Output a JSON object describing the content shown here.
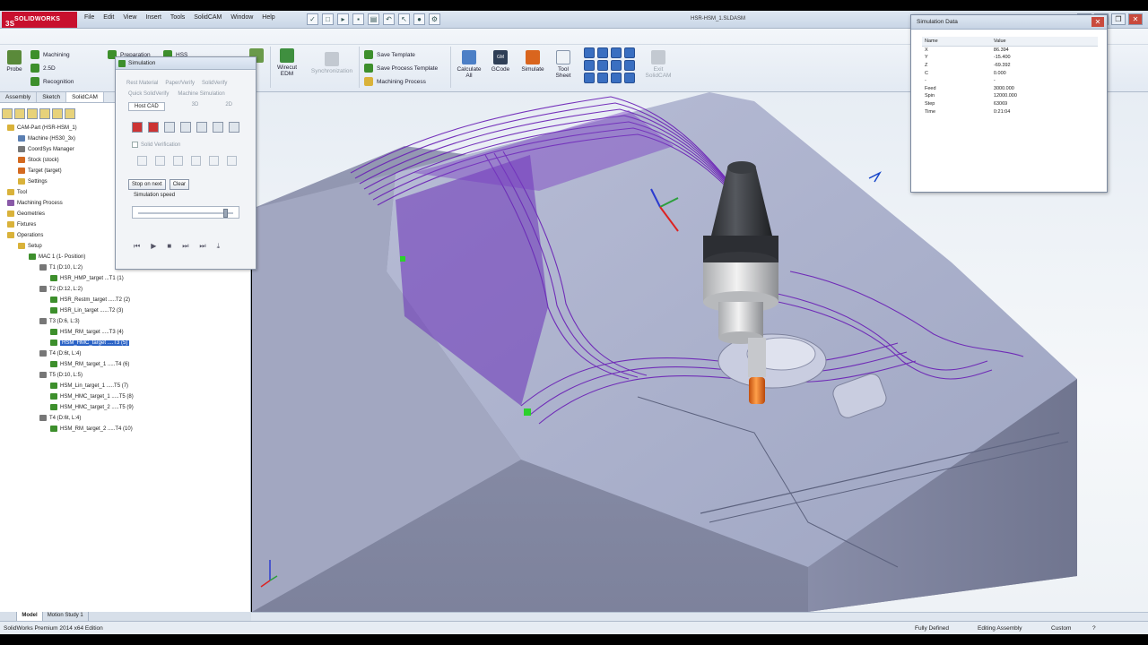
{
  "app": {
    "logo_text": "SOLIDWORKS",
    "document_title": "HSR-HSM_1.SLDASM"
  },
  "menu": [
    "File",
    "Edit",
    "View",
    "Insert",
    "Tools",
    "SolidCAM",
    "Window",
    "Help"
  ],
  "command_manager": {
    "probe": "Probe",
    "machining": "Machining",
    "two_five_d": "2.5D",
    "recognition": "Recognition",
    "preparation": "Preparation",
    "hss": "HSS",
    "simulation": "Simulation",
    "wirecut_edm": "Wirecut EDM",
    "synchronization": "Synchronization",
    "save_template": "Save Template",
    "save_process_template": "Save Process Template",
    "machining_process": "Machining Process",
    "calculate_all": "Calculate All",
    "gcode": "GCode",
    "simulate": "Simulate",
    "tool_sheet": "Tool Sheet",
    "exit_solidcam": "Exit SolidCAM"
  },
  "tabs": [
    "Assembly",
    "Sketch",
    "SolidCAM"
  ],
  "tree": [
    {
      "label": "CAM-Part (HSR-HSM_1)",
      "icon": "cam-part-icon"
    },
    {
      "label": "Machine (HS30_3x)",
      "icon": "machine-icon"
    },
    {
      "label": "CoordSys Manager",
      "icon": "coordsys-icon"
    },
    {
      "label": "Stock (stock)",
      "icon": "stock-icon"
    },
    {
      "label": "Target (target)",
      "icon": "target-icon"
    },
    {
      "label": "Settings",
      "icon": "settings-icon"
    },
    {
      "label": "Tool",
      "icon": "tool-icon"
    },
    {
      "label": "Machining Process",
      "icon": "process-icon"
    },
    {
      "label": "Geometries",
      "icon": "geometries-icon"
    },
    {
      "label": "Fixtures",
      "icon": "fixtures-icon"
    },
    {
      "label": "Operations",
      "icon": "operations-icon"
    },
    {
      "label": "Setup",
      "icon": "setup-icon"
    },
    {
      "label": "MAC 1 (1- Position)",
      "icon": "mac-icon"
    },
    {
      "label": "T1 (D:10, L:2)",
      "icon": "tool-group-icon"
    },
    {
      "label": "HSR_HMP_target ...T1 (1)",
      "icon": "operation-icon"
    },
    {
      "label": "T2 (D:12, L:2)",
      "icon": "tool-group-icon"
    },
    {
      "label": "HSR_Restm_target .....T2 (2)",
      "icon": "operation-icon"
    },
    {
      "label": "HSR_Lin_target ......T2 (3)",
      "icon": "operation-icon"
    },
    {
      "label": "T3 (D:6, L:3)",
      "icon": "tool-group-icon"
    },
    {
      "label": "HSM_RM_target .....T3 (4)",
      "icon": "operation-icon"
    },
    {
      "label": "HSM_HMC_target ....T3 (5)",
      "icon": "operation-icon"
    },
    {
      "label": "T4 (D:6t, L:4)",
      "icon": "tool-group-icon"
    },
    {
      "label": "HSM_RM_target_1 .....T4 (6)",
      "icon": "operation-icon"
    },
    {
      "label": "T5 (D:10, L:5)",
      "icon": "tool-group-icon"
    },
    {
      "label": "HSM_Lin_target_1 .....T5 (7)",
      "icon": "operation-icon"
    },
    {
      "label": "HSM_HMC_target_1 .....T5 (8)",
      "icon": "operation-icon"
    },
    {
      "label": "HSM_HMC_target_2 .....T5 (9)",
      "icon": "operation-icon"
    },
    {
      "label": "T4 (D:6t, L:4)",
      "icon": "tool-group-icon"
    },
    {
      "label": "HSM_RM_target_2 .....T4 (10)",
      "icon": "operation-icon"
    }
  ],
  "simulation": {
    "title": "Simulation",
    "tabs_row1": [
      "Rest Material",
      "Paper/Verify",
      "SolidVerify"
    ],
    "tabs_row2": [
      "Quick SolidVerify",
      "Machine Simulation"
    ],
    "tabs_row3": [
      "Host CAD",
      "3D",
      "2D"
    ],
    "solid_verification": "Solid Verification",
    "stop_on_next": "Stop on next",
    "clear": "Clear",
    "speed_label": "Simulation speed",
    "speed": 0.9
  },
  "sim_data": {
    "title": "Simulation Data",
    "columns": [
      "Name",
      "Value"
    ],
    "rows": [
      [
        "X",
        "86.394"
      ],
      [
        "Y",
        "-15.400"
      ],
      [
        "Z",
        "-69.392"
      ],
      [
        "C",
        "0.000"
      ],
      [
        "-",
        "-"
      ],
      [
        "Feed",
        "3000.000"
      ],
      [
        "Spin",
        "12000.000"
      ],
      [
        "Step",
        "63069"
      ],
      [
        "Time",
        "0:21:04"
      ]
    ]
  },
  "bottom_tabs": [
    "Model",
    "Motion Study 1"
  ],
  "status": {
    "left": "SolidWorks Premium 2014 x64 Edition",
    "defined": "Fully Defined",
    "editing": "Editing Assembly",
    "units": "Custom"
  },
  "colors": {
    "toolpath": "#6a1fb5",
    "part": "#a7aec9",
    "selection": "#2b63c6",
    "tool_tip": "#e0701c"
  }
}
